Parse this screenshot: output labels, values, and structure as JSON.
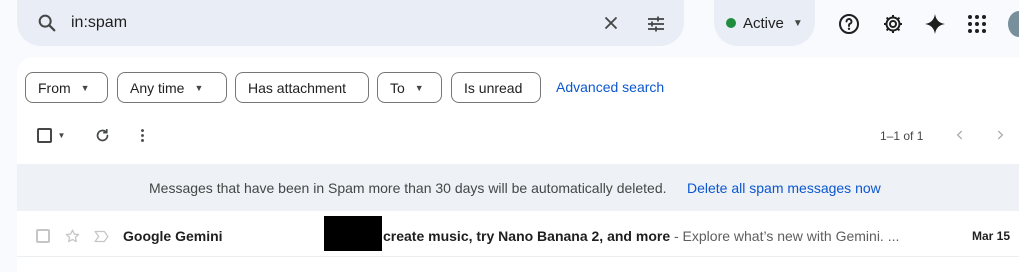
{
  "search": {
    "query": "in:spam"
  },
  "status": {
    "label": "Active",
    "color": "#1e8e3e"
  },
  "header_icons": [
    "help-icon",
    "settings-icon",
    "gemini-sparkle-icon",
    "apps-grid-icon"
  ],
  "filters": {
    "chips": [
      {
        "label": "From",
        "has_dropdown": true
      },
      {
        "label": "Any time",
        "has_dropdown": true
      },
      {
        "label": "Has attachment",
        "has_dropdown": false
      },
      {
        "label": "To",
        "has_dropdown": true
      },
      {
        "label": "Is unread",
        "has_dropdown": false
      }
    ],
    "advanced_label": "Advanced search"
  },
  "toolbar": {
    "pagination": "1–1 of 1"
  },
  "notice": {
    "text": "Messages that have been in Spam more than 30 days will be automatically deleted.",
    "action": "Delete all spam messages now"
  },
  "emails": [
    {
      "sender": "Google Gemini",
      "subject": "create music, try Nano Banana 2, and more",
      "snippet": " - Explore what’s new with Gemini.  ...",
      "date": "Mar 15"
    }
  ],
  "colors": {
    "accent": "#0b57d0",
    "surface": "#e9eef6"
  }
}
